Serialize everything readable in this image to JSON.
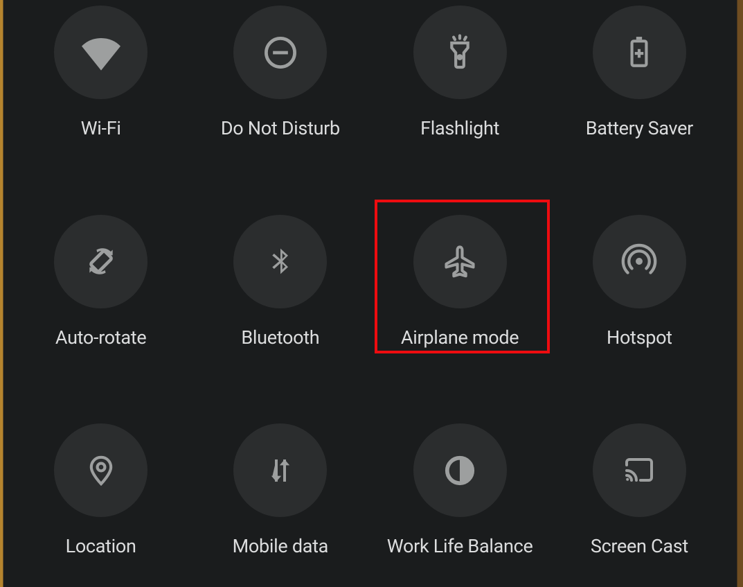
{
  "tiles": [
    {
      "id": "wifi",
      "label": "Wi-Fi"
    },
    {
      "id": "dnd",
      "label": "Do Not Disturb"
    },
    {
      "id": "flashlight",
      "label": "Flashlight"
    },
    {
      "id": "battery-saver",
      "label": "Battery Saver"
    },
    {
      "id": "auto-rotate",
      "label": "Auto-rotate"
    },
    {
      "id": "bluetooth",
      "label": "Bluetooth"
    },
    {
      "id": "airplane",
      "label": "Airplane mode"
    },
    {
      "id": "hotspot",
      "label": "Hotspot"
    },
    {
      "id": "location",
      "label": "Location"
    },
    {
      "id": "mobile-data",
      "label": "Mobile data"
    },
    {
      "id": "work-life",
      "label": "Work Life Balance"
    },
    {
      "id": "screen-cast",
      "label": "Screen Cast"
    }
  ],
  "highlighted": "airplane",
  "colors": {
    "panel": "#1a1c1d",
    "circle": "#2b2d2e",
    "icon": "#9d9f9f",
    "label": "#dcddde",
    "highlight": "#ee0c10"
  }
}
